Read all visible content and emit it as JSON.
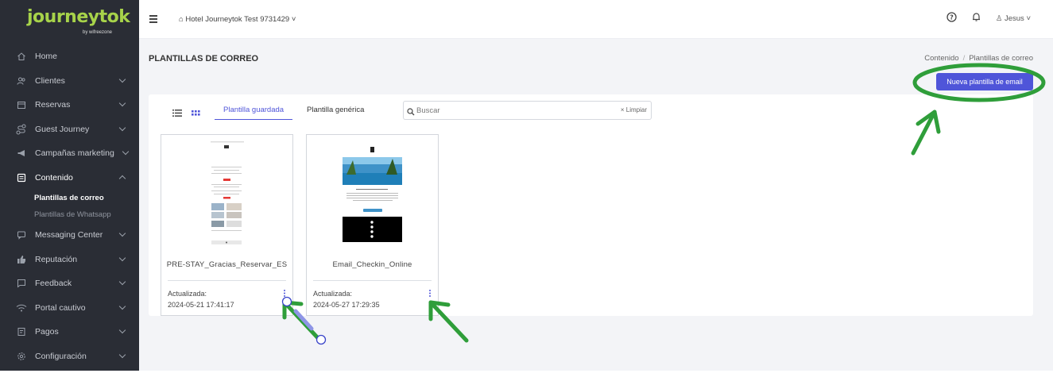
{
  "brand": {
    "name": "journeytok",
    "byline": "by wifreezone",
    "accent": "#a7d34a"
  },
  "sidebar": {
    "items": [
      {
        "label": "Home",
        "icon": "home-icon"
      },
      {
        "label": "Clientes",
        "icon": "users-icon"
      },
      {
        "label": "Reservas",
        "icon": "calendar-icon"
      },
      {
        "label": "Guest Journey",
        "icon": "route-icon"
      },
      {
        "label": "Campañas marketing",
        "icon": "megaphone-icon"
      },
      {
        "label": "Contenido",
        "icon": "document-icon"
      },
      {
        "label": "Messaging Center",
        "icon": "chat-icon"
      },
      {
        "label": "Reputación",
        "icon": "thumbs-up-icon"
      },
      {
        "label": "Feedback",
        "icon": "feedback-icon"
      },
      {
        "label": "Portal cautivo",
        "icon": "wifi-icon"
      },
      {
        "label": "Pagos",
        "icon": "receipt-icon"
      },
      {
        "label": "Configuración",
        "icon": "gear-icon"
      }
    ],
    "sub": {
      "templates": "Plantillas de correo",
      "whatsapp": "Plantillas de Whatsapp"
    }
  },
  "topbar": {
    "hotel": "Hotel Journeytok Test 9731429",
    "user": "Jesus"
  },
  "page": {
    "title": "PLANTILLAS DE CORREO",
    "breadcrumb": [
      "Contenido",
      "Plantillas de correo"
    ],
    "new_button": "Nueva plantilla de email",
    "accent": "#4f55d9"
  },
  "tabs": {
    "saved": "Plantilla guardada",
    "generic": "Plantilla genérica"
  },
  "search": {
    "placeholder": "Buscar",
    "clear": "Limpiar"
  },
  "templates": [
    {
      "name": "PRE-STAY_Gracias_Reservar_ES",
      "updated_label": "Actualizada:",
      "updated": "2024-05-21 17:41:17"
    },
    {
      "name": "Email_Checkin_Online",
      "updated_label": "Actualizada:",
      "updated": "2024-05-27 17:29:35"
    }
  ],
  "annotation_color": "#2f9e3a"
}
